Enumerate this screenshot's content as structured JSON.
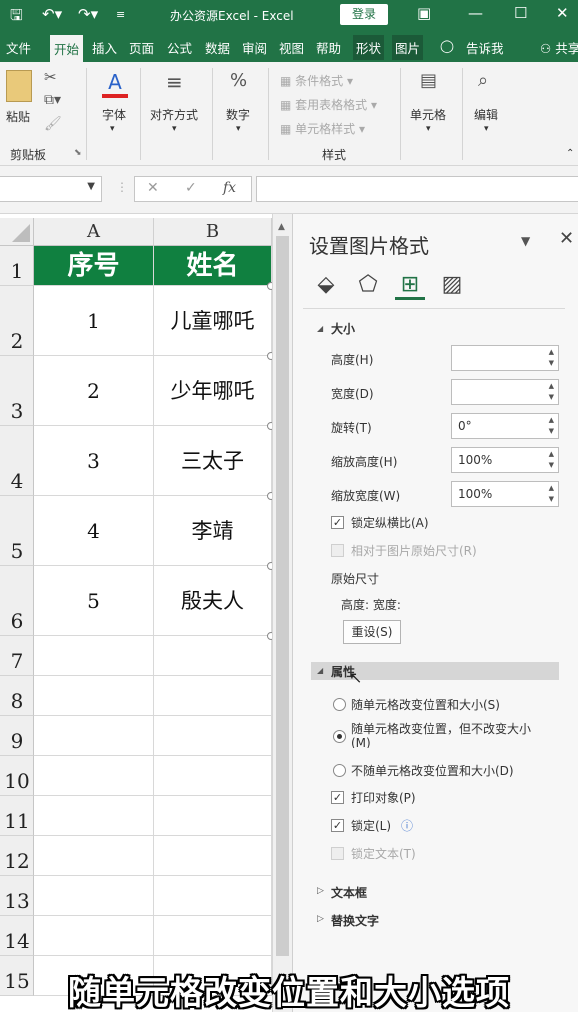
{
  "titlebar": {
    "title": "办公资源Excel  -  Excel",
    "login": "登录",
    "save_icon": "save-icon",
    "undo_icon": "undo-icon",
    "redo_icon": "redo-icon"
  },
  "tabs": [
    "文件",
    "开始",
    "插入",
    "页面",
    "公式",
    "数据",
    "审阅",
    "视图",
    "帮助",
    "形状",
    "图片",
    "告诉我",
    "共享"
  ],
  "ribbon": {
    "paste": "粘贴",
    "clipboard": "剪贴板",
    "font": "字体",
    "align": "对齐方式",
    "number": "数字",
    "cond_format": "条件格式",
    "table_format": "套用表格格式",
    "cell_style": "单元格样式",
    "styles": "样式",
    "cells": "单元格",
    "edit": "编辑",
    "font_glyph": "A",
    "percent_glyph": "%"
  },
  "formula": {
    "fx": "fx",
    "cancel": "✕",
    "confirm": "✓"
  },
  "sheet": {
    "columns": [
      "A",
      "B"
    ],
    "rows": [
      "1",
      "2",
      "3",
      "4",
      "5",
      "6",
      "7",
      "8",
      "9",
      "10",
      "11",
      "12",
      "13",
      "14",
      "15"
    ],
    "header": [
      "序号",
      "姓名"
    ],
    "data": [
      [
        "1",
        "儿童哪吒"
      ],
      [
        "2",
        "少年哪吒"
      ],
      [
        "3",
        "三太子"
      ],
      [
        "4",
        "李靖"
      ],
      [
        "5",
        "殷夫人"
      ]
    ]
  },
  "pane": {
    "title": "设置图片格式",
    "size_section": "大小",
    "height_label": "高度(H)",
    "width_label": "宽度(D)",
    "rotate_label": "旋转(T)",
    "scale_h_label": "缩放高度(H)",
    "scale_w_label": "缩放宽度(W)",
    "height_value": "",
    "width_value": "",
    "rotate_value": "0°",
    "scale_h_value": "100%",
    "scale_w_value": "100%",
    "lock_ratio": "锁定纵横比(A)",
    "relative_original": "相对于图片原始尺寸(R)",
    "original_size": "原始尺寸",
    "orig_hw": "高度:  宽度:",
    "reset": "重设(S)",
    "props_section": "属性",
    "opt1": "随单元格改变位置和大小(S)",
    "opt2": "随单元格改变位置，但不改变大小(M)",
    "opt3": "不随单元格改变位置和大小(D)",
    "print": "打印对象(P)",
    "locked": "锁定(L)",
    "lock_text": "锁定文本(T)",
    "textbox_section": "文本框",
    "alt_section": "替换文字"
  },
  "subtitle": "随单元格改变位置和大小选项"
}
